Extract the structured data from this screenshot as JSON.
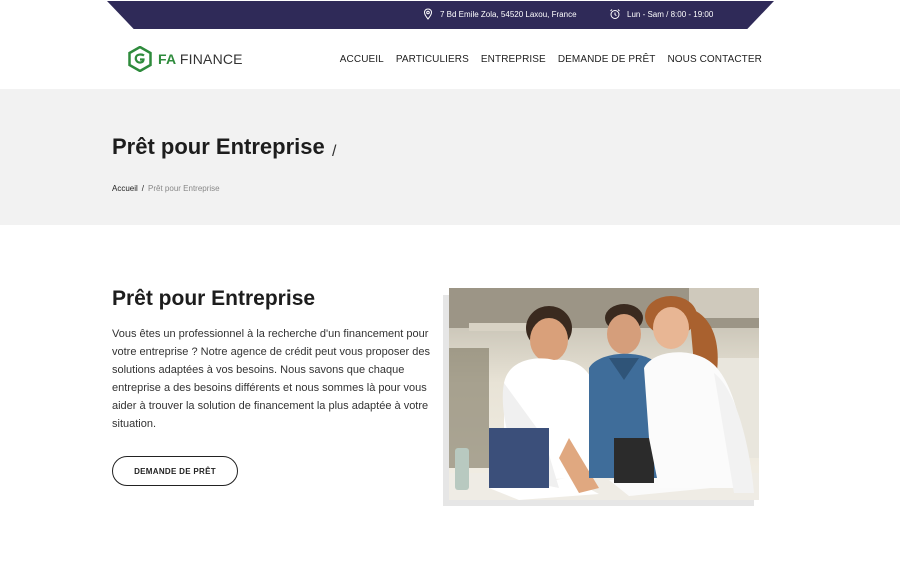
{
  "topbar": {
    "address": "7 Bd Emile Zola, 54520 Laxou, France",
    "hours": "Lun - Sam / 8:00 - 19:00"
  },
  "logo": {
    "fa": "FA",
    "finance": "FINANCE"
  },
  "nav": [
    "ACCUEIL",
    "PARTICULIERS",
    "ENTREPRISE",
    "DEMANDE DE PRÊT",
    "NOUS CONTACTER"
  ],
  "hero": {
    "title": "Prêt pour Entreprise",
    "slash": "/",
    "breadcrumb": {
      "home": "Accueil",
      "sep": "/",
      "current": "Prêt pour Entreprise"
    }
  },
  "content": {
    "title": "Prêt pour Entreprise",
    "text": "Vous êtes un professionnel à la recherche d'un financement pour votre entreprise ? Notre agence de crédit peut vous proposer des solutions adaptées à vos besoins. Nous savons que chaque entreprise a des besoins différents et nous sommes là pour vous aider à trouver la solution de financement la plus adaptée à votre situation.",
    "cta": "DEMANDE DE PRÊT"
  },
  "colors": {
    "topbar": "#2f2a58",
    "brand_green": "#2e8b3c",
    "hero_bg": "#f2f2f2"
  },
  "icons": {
    "address": "map-pin-icon",
    "hours": "alarm-clock-icon"
  }
}
